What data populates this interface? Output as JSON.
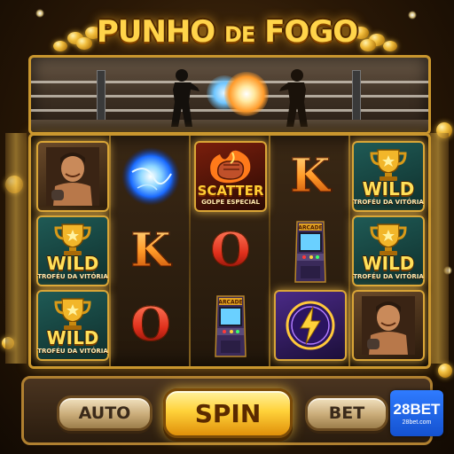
{
  "title": {
    "part1": "PUNHO",
    "part2": "DE",
    "part3": "FOGO"
  },
  "symbols": {
    "wild": "WILD",
    "wild_sub": "TROFÉU DA VITÓRIA",
    "scatter": "SCATTER",
    "scatter_sub": "GOLPE ESPECIAL",
    "letter_k": "K",
    "letter_o": "O",
    "arcade": "ARCADE"
  },
  "reels": [
    [
      "fighter-portrait",
      "wild",
      "wild"
    ],
    [
      "energy-orb",
      "letter-k",
      "letter-o"
    ],
    [
      "scatter",
      "letter-o",
      "arcade-cabinet"
    ],
    [
      "letter-k",
      "arcade-cabinet",
      "lightning-orb"
    ],
    [
      "wild",
      "wild",
      "fighter-portrait"
    ]
  ],
  "controls": {
    "auto": "AUTO",
    "spin": "SPIN",
    "bet": "BET"
  },
  "brand": {
    "name": "28BET",
    "url": "28bet.com"
  },
  "colors": {
    "gold": "#ffd44a",
    "frame": "#c9962e",
    "brand_blue": "#1e63f0"
  }
}
